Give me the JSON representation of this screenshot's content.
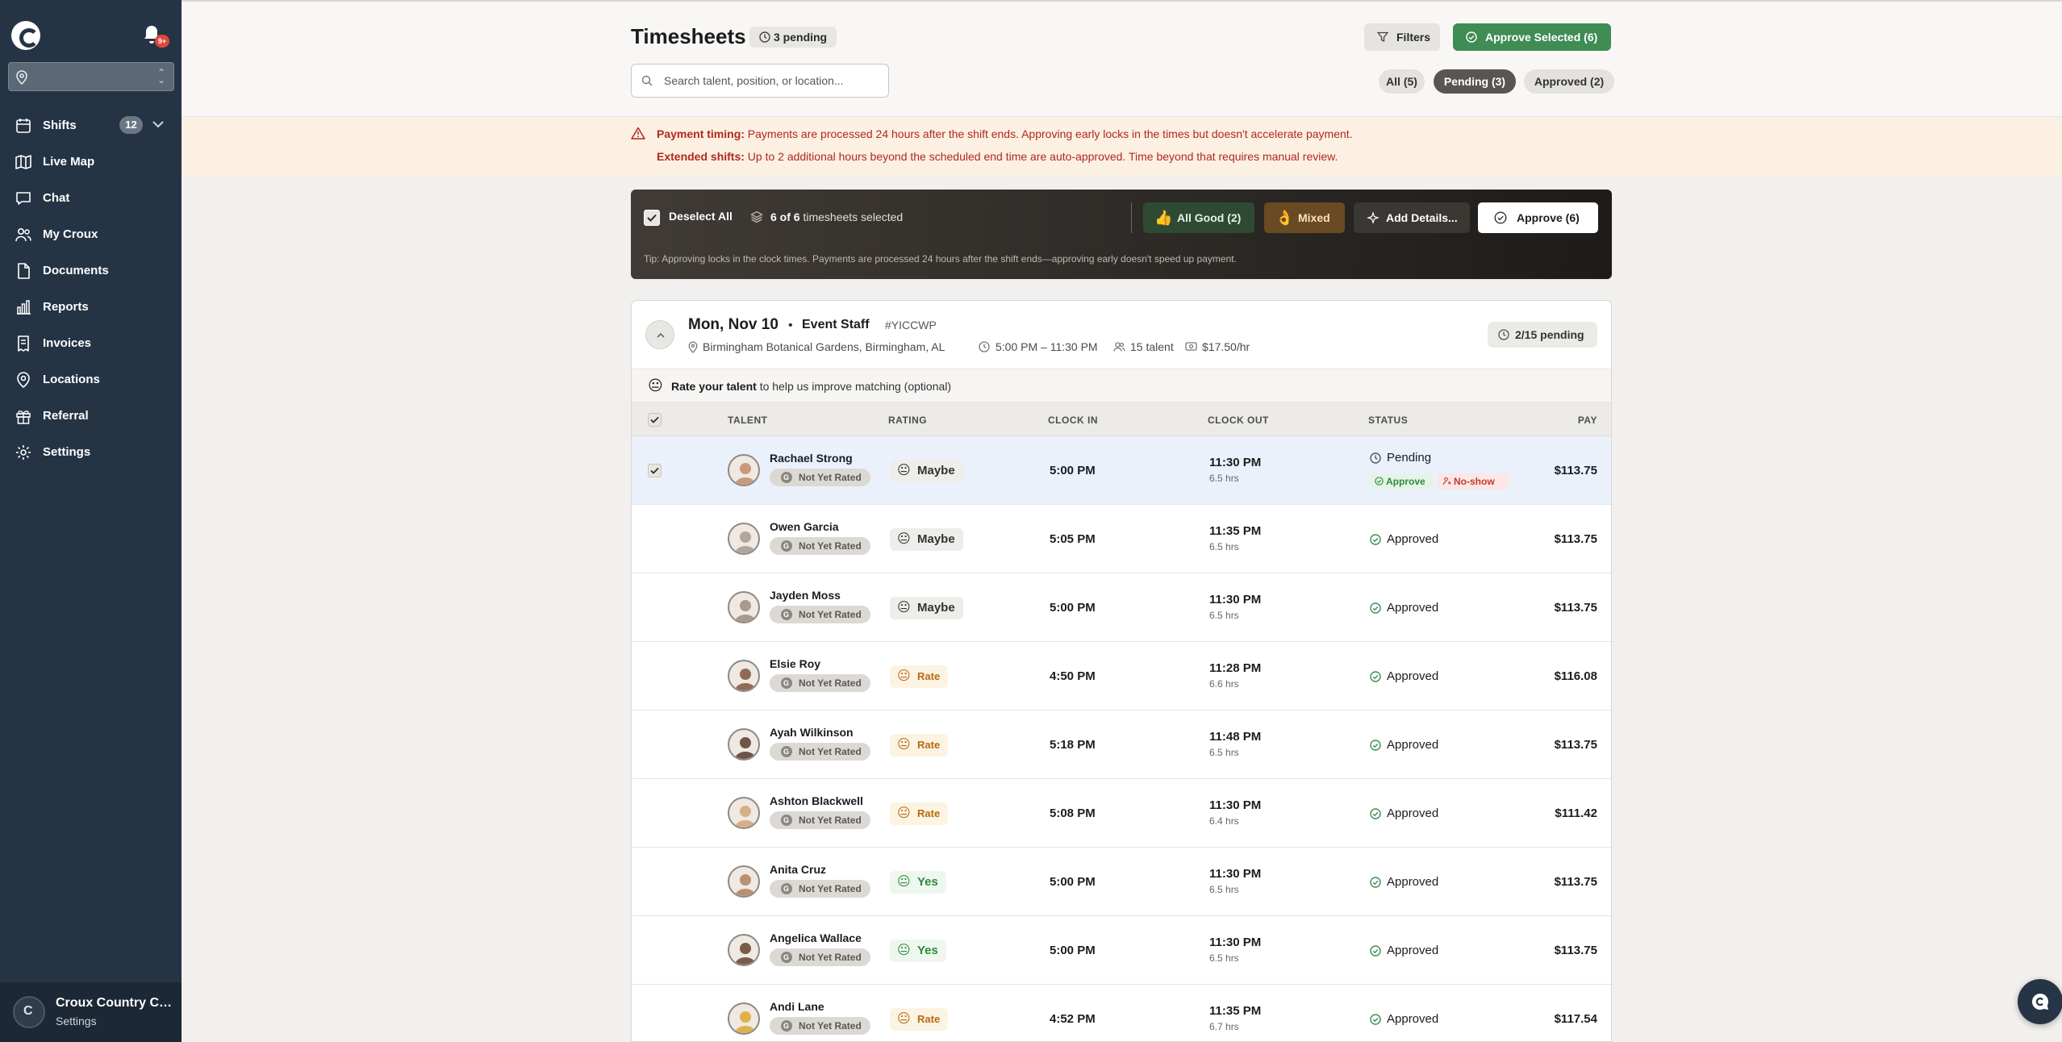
{
  "sidebar": {
    "notification_badge": "9+",
    "location_selector_value": "",
    "nav": [
      {
        "label": "Shifts",
        "icon": "calendar-icon",
        "count": "12"
      },
      {
        "label": "Live Map",
        "icon": "map-icon"
      },
      {
        "label": "Chat",
        "icon": "chat-icon"
      },
      {
        "label": "My Croux",
        "icon": "users-icon"
      },
      {
        "label": "Documents",
        "icon": "document-icon"
      },
      {
        "label": "Reports",
        "icon": "bar-chart-icon"
      },
      {
        "label": "Invoices",
        "icon": "invoice-icon"
      },
      {
        "label": "Locations",
        "icon": "location-pin-icon"
      },
      {
        "label": "Referral",
        "icon": "gift-icon"
      },
      {
        "label": "Settings",
        "icon": "gear-icon"
      }
    ],
    "footer": {
      "org_name": "Croux Country Club",
      "subtitle": "Settings",
      "avatar_letter": "C"
    }
  },
  "header": {
    "title": "Timesheets",
    "pending_chip": "3 pending",
    "filters_label": "Filters",
    "approve_selected_label": "Approve Selected (6)",
    "search_placeholder": "Search talent, position, or location...",
    "tabs": [
      {
        "label": "All (5)",
        "active": false
      },
      {
        "label": "Pending (3)",
        "active": true
      },
      {
        "label": "Approved (2)",
        "active": false
      }
    ]
  },
  "notice": {
    "line1_bold": "Payment timing:",
    "line1_text": " Payments are processed 24 hours after the shift ends. Approving early locks in the times but doesn't accelerate payment.",
    "line2_bold": "Extended shifts:",
    "line2_text": " Up to 2 additional hours beyond the scheduled end time are auto-approved. Time beyond that requires manual review."
  },
  "selection_bar": {
    "deselect_label": "Deselect All",
    "count_bold": "6 of 6",
    "count_text": " timesheets selected",
    "all_good_label": "All Good (2)",
    "mixed_label": "Mixed",
    "add_details_label": "Add Details...",
    "approve_label": "Approve (6)",
    "tip": "Tip: Approving locks in the clock times. Payments are processed 24 hours after the shift ends—approving early doesn't speed up payment."
  },
  "shift": {
    "date": "Mon, Nov 10",
    "bullet": "•",
    "role": "Event Staff",
    "code": "#YICCWP",
    "location": "Birmingham Botanical Gardens, Birmingham, AL",
    "time_range": "5:00 PM – 11:30 PM",
    "talent_count": "15 talent",
    "pay_rate": "$17.50/hr",
    "pending_chip": "2/15 pending",
    "rate_prompt_bold": "Rate your talent",
    "rate_prompt_text": " to help us improve matching (optional)",
    "columns": [
      "TALENT",
      "RATING",
      "CLOCK IN",
      "CLOCK OUT",
      "STATUS",
      "PAY"
    ],
    "rows": [
      {
        "name": "Rachael Strong",
        "badge": "Not Yet Rated",
        "rating": "Maybe",
        "rating_kind": "maybe",
        "clock_in": "5:00 PM",
        "clock_out": "11:30 PM",
        "hours": "6.5 hrs",
        "status": "Pending",
        "approve_label": "Approve",
        "noshow_label": "No-show",
        "pay": "$113.75",
        "selected": true
      },
      {
        "name": "Owen Garcia",
        "badge": "Not Yet Rated",
        "rating": "Maybe",
        "rating_kind": "maybe",
        "clock_in": "5:05 PM",
        "clock_out": "11:35 PM",
        "hours": "6.5 hrs",
        "status": "Approved",
        "pay": "$113.75"
      },
      {
        "name": "Jayden Moss",
        "badge": "Not Yet Rated",
        "rating": "Maybe",
        "rating_kind": "maybe",
        "clock_in": "5:00 PM",
        "clock_out": "11:30 PM",
        "hours": "6.5 hrs",
        "status": "Approved",
        "pay": "$113.75"
      },
      {
        "name": "Elsie Roy",
        "badge": "Not Yet Rated",
        "rating": "Rate",
        "rating_kind": "rate",
        "clock_in": "4:50 PM",
        "clock_out": "11:28 PM",
        "hours": "6.6 hrs",
        "status": "Approved",
        "pay": "$116.08"
      },
      {
        "name": "Ayah Wilkinson",
        "badge": "Not Yet Rated",
        "rating": "Rate",
        "rating_kind": "rate",
        "clock_in": "5:18 PM",
        "clock_out": "11:48 PM",
        "hours": "6.5 hrs",
        "status": "Approved",
        "pay": "$113.75"
      },
      {
        "name": "Ashton Blackwell",
        "badge": "Not Yet Rated",
        "rating": "Rate",
        "rating_kind": "rate",
        "clock_in": "5:08 PM",
        "clock_out": "11:30 PM",
        "hours": "6.4 hrs",
        "status": "Approved",
        "pay": "$111.42"
      },
      {
        "name": "Anita Cruz",
        "badge": "Not Yet Rated",
        "rating": "Yes",
        "rating_kind": "yes",
        "clock_in": "5:00 PM",
        "clock_out": "11:30 PM",
        "hours": "6.5 hrs",
        "status": "Approved",
        "pay": "$113.75"
      },
      {
        "name": "Angelica Wallace",
        "badge": "Not Yet Rated",
        "rating": "Yes",
        "rating_kind": "yes",
        "clock_in": "5:00 PM",
        "clock_out": "11:30 PM",
        "hours": "6.5 hrs",
        "status": "Approved",
        "pay": "$113.75"
      },
      {
        "name": "Andi Lane",
        "badge": "Not Yet Rated",
        "rating": "Rate",
        "rating_kind": "rate",
        "clock_in": "4:52 PM",
        "clock_out": "11:35 PM",
        "hours": "6.7 hrs",
        "status": "Approved",
        "pay": "$117.54"
      }
    ]
  },
  "colors": {
    "sidebar_bg": "#253445",
    "primary_green": "#3f8c54",
    "warning_text": "#b3271f",
    "notice_bg": "#fbf0e2",
    "selected_row": "#eaf1fb"
  }
}
